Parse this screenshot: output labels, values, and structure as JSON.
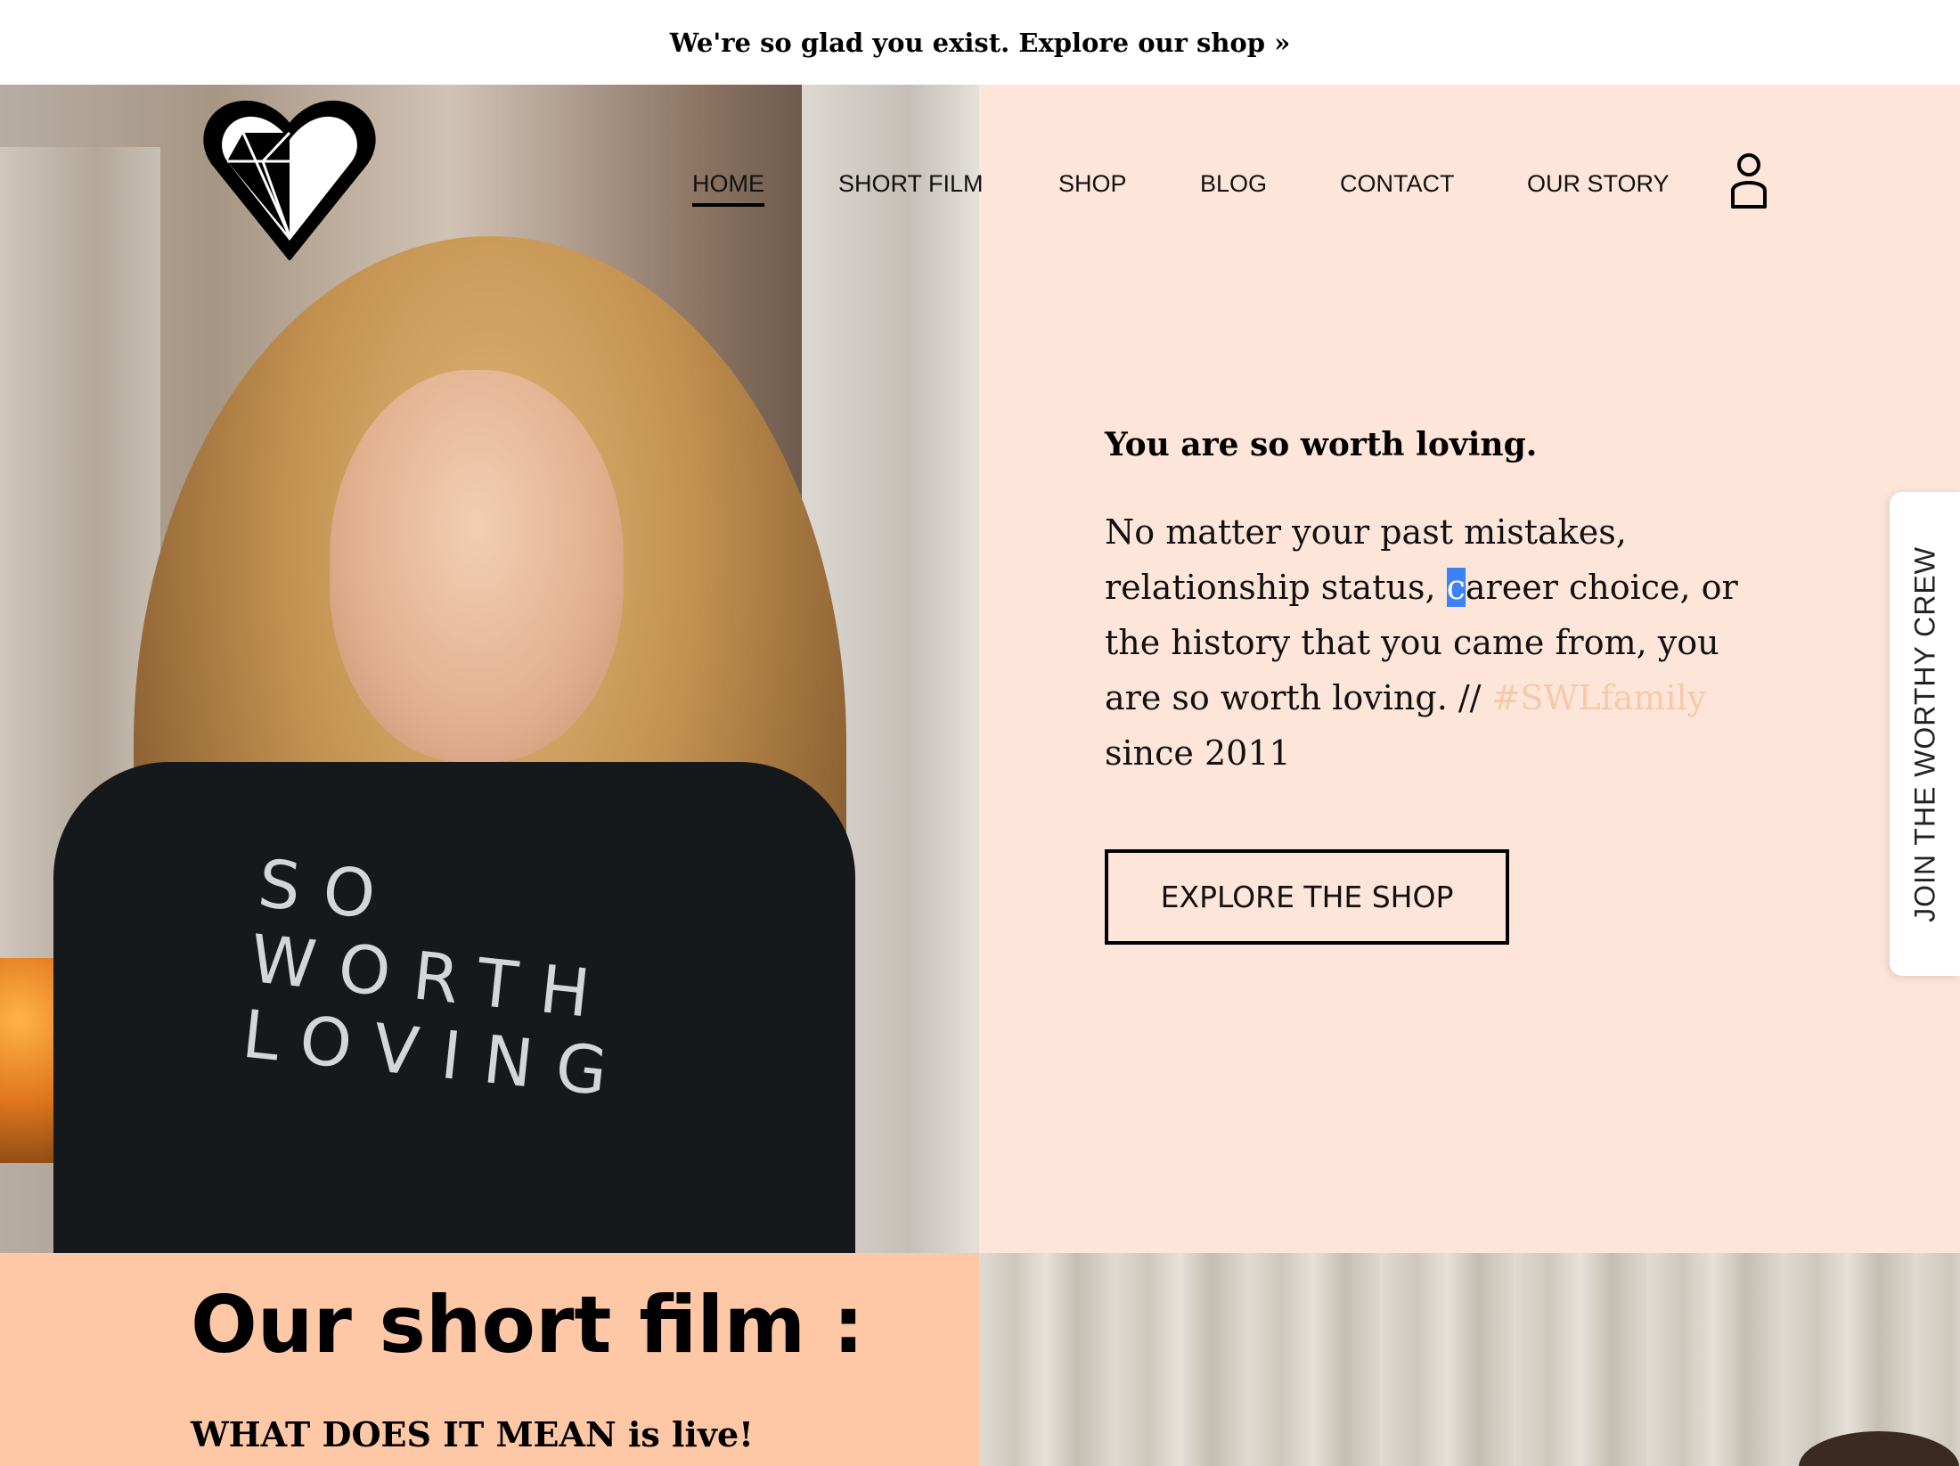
{
  "announcement": {
    "text": "We're so glad you exist. Explore our shop »"
  },
  "nav": {
    "items": [
      {
        "label": "HOME",
        "active": true
      },
      {
        "label": "SHORT FILM",
        "active": false
      },
      {
        "label": "SHOP",
        "active": false
      },
      {
        "label": "BLOG",
        "active": false
      },
      {
        "label": "CONTACT",
        "active": false
      },
      {
        "label": "OUR STORY",
        "active": false
      }
    ],
    "account_icon": "user-account-icon"
  },
  "logo": {
    "icon": "diamond-heart-logo"
  },
  "hero": {
    "shirt_text_line1": "SO WORTH",
    "shirt_text_line2": "LOVING",
    "title": "You are so worth loving.",
    "body_before_selection": "No matter your past mistakes, relationship status, ",
    "body_selected_char": "c",
    "body_after_selection": "areer choice, or the history that you came from, you are so worth loving. // ",
    "hashtag": "#SWLfamily",
    "body_end": " since 2011",
    "cta_label": "EXPLORE THE SHOP"
  },
  "side_tab": {
    "label": "JOIN THE WORTHY CREW"
  },
  "film": {
    "title": "Our short film :",
    "subtitle": "WHAT DOES IT MEAN is live!"
  },
  "colors": {
    "hero_panel_bg": "#fde5d9",
    "film_panel_bg": "#fec8a6",
    "hashtag": "#f7c9a8",
    "selection": "#3b82f6"
  }
}
